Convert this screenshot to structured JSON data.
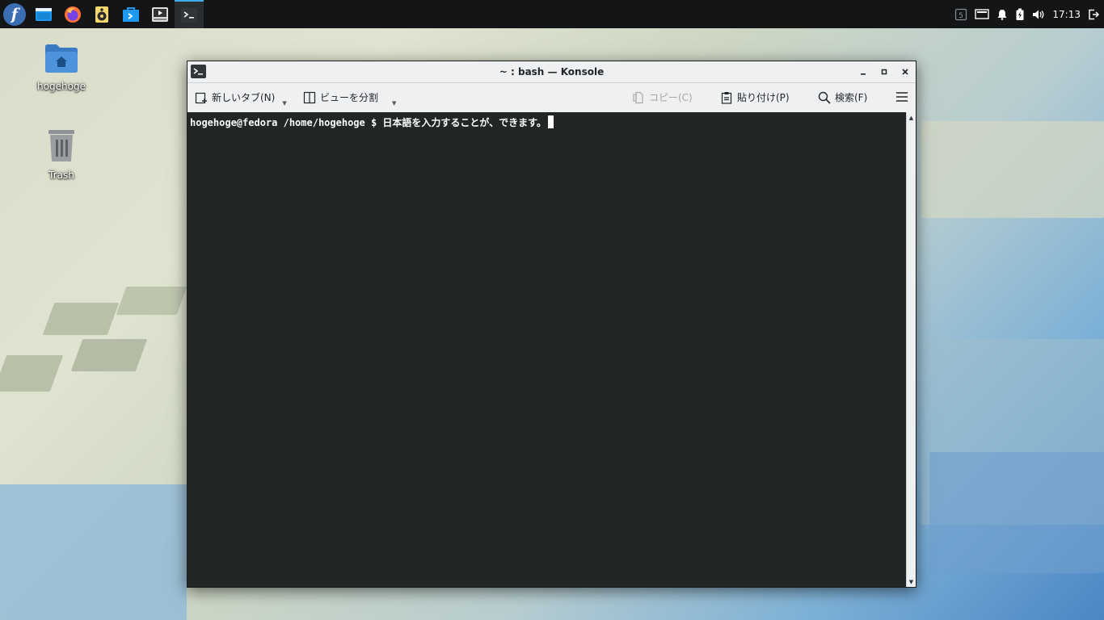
{
  "panel": {
    "launcher_icon": "fedora-logo-icon",
    "tasks": [
      {
        "name": "file-manager-icon"
      },
      {
        "name": "firefox-icon"
      },
      {
        "name": "music-player-icon"
      },
      {
        "name": "software-center-icon"
      },
      {
        "name": "media-player-icon"
      },
      {
        "name": "konsole-icon"
      }
    ],
    "tray": {
      "clock": "17:13"
    }
  },
  "desktop": {
    "icons": [
      {
        "label": "hogehoge",
        "icon": "home-folder-icon"
      },
      {
        "label": "Trash",
        "icon": "trash-icon"
      }
    ]
  },
  "window": {
    "title": "~ : bash — Konsole",
    "toolbar": {
      "new_tab": "新しいタブ(N)",
      "split_view": "ビューを分割",
      "copy": "コピー(C)",
      "paste": "貼り付け(P)",
      "find": "検索(F)"
    },
    "terminal": {
      "prompt": "hogehoge@fedora /home/hogehoge $ ",
      "input": "日本語を入力することが、できます。"
    }
  },
  "colors": {
    "accent": "#3daee9",
    "panel_bg": "#131517",
    "terminal_bg": "#232627",
    "titlebar_bg": "#eff0f1"
  }
}
